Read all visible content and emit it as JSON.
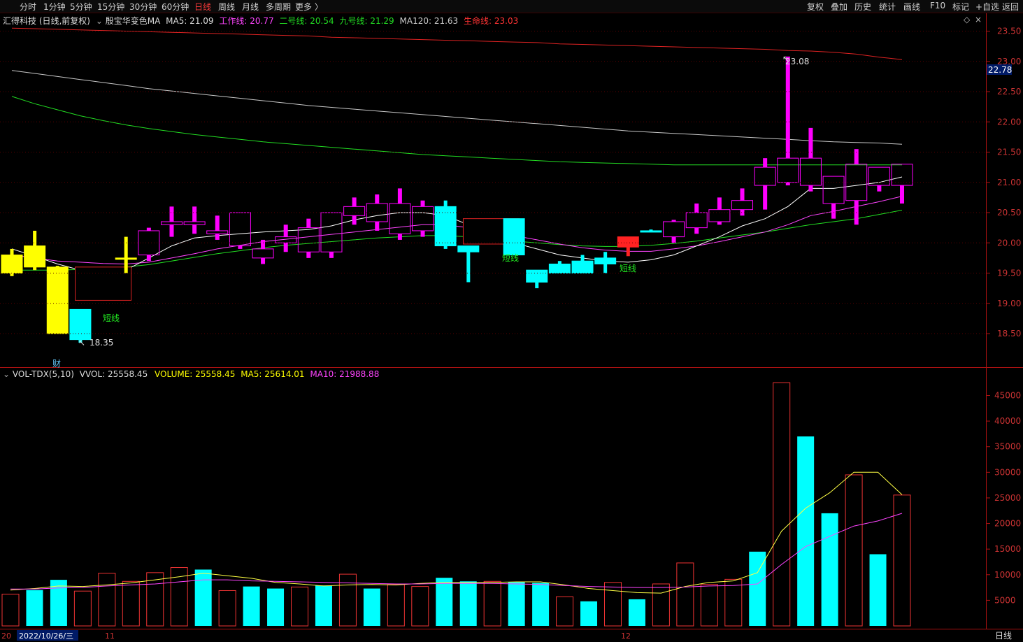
{
  "toolbar": {
    "left_tabs": [
      "分时",
      "1分钟",
      "5分钟",
      "15分钟",
      "30分钟",
      "60分钟",
      "日线",
      "周线",
      "月线",
      "多周期",
      "更多 〉"
    ],
    "active_tab": "日线",
    "right_buttons": [
      "复权",
      "叠加",
      "历史",
      "统计",
      "画线",
      "F10",
      "标记",
      "+自选",
      "返回"
    ]
  },
  "colors": {
    "up": "#ff00ff",
    "down": "#00ffff",
    "yellow": "#ffff00",
    "ma_white": "#ffffff",
    "ma_magenta": "#ff44ff",
    "ma_green": "#22dd22",
    "ma120": "#c8c8c8",
    "lifeline": "#dd2222",
    "grid": "#5a0000",
    "axis": "#aa1111"
  },
  "price_legend": {
    "stock": "汇得科技 (日线,前复权)",
    "indicator": "殷宝华变色MA",
    "ma5": "MA5: 21.09",
    "work": "工作线: 20.77",
    "second": "二号线: 20.54",
    "nine": "九号线: 21.29",
    "ma120": "MA120: 21.63",
    "life": "生命线: 23.03"
  },
  "vol_legend": {
    "name": "VOL-TDX(5,10)",
    "vvol": "VVOL: 25558.45",
    "volume": "VOLUME: 25558.45",
    "ma5": "MA5: 25614.01",
    "ma10": "MA10: 21988.88"
  },
  "current_price_tag": "22.78",
  "period_label": "日线",
  "annotations": {
    "high_label": "23.08",
    "low_label": "18.35",
    "short_label": "短线",
    "cai_label": "财"
  },
  "x_axis": {
    "start": "20",
    "date": "2022/10/26/三",
    "m11": "11",
    "m12": "12"
  },
  "chart_data": [
    {
      "type": "candlestick",
      "title": "汇得科技 (日线,前复权)",
      "y_ticks": [
        23.5,
        23.0,
        22.5,
        22.0,
        21.5,
        21.0,
        20.5,
        20.0,
        19.5,
        19.0,
        18.5
      ],
      "ylim": [
        18.0,
        23.8
      ],
      "candles": [
        {
          "o": 19.5,
          "h": 19.9,
          "l": 19.45,
          "c": 19.8,
          "t": "yellow"
        },
        {
          "o": 19.6,
          "h": 20.2,
          "l": 19.55,
          "c": 19.95,
          "t": "yellow"
        },
        {
          "o": 19.6,
          "h": 19.62,
          "l": 18.5,
          "c": 18.5,
          "t": "yellow"
        },
        {
          "o": 18.9,
          "h": 18.9,
          "l": 18.35,
          "c": 18.4,
          "t": "down"
        },
        {
          "o": 19.05,
          "h": 19.62,
          "l": 19.05,
          "c": 19.6,
          "t": "box"
        },
        {
          "o": 19.75,
          "h": 20.1,
          "l": 19.5,
          "c": 19.75,
          "t": "yellow"
        },
        {
          "o": 19.8,
          "h": 20.25,
          "l": 19.7,
          "c": 20.2,
          "t": "up"
        },
        {
          "o": 20.3,
          "h": 20.6,
          "l": 20.1,
          "c": 20.35,
          "t": "up"
        },
        {
          "o": 20.35,
          "h": 20.6,
          "l": 20.15,
          "c": 20.3,
          "t": "up"
        },
        {
          "o": 20.15,
          "h": 20.45,
          "l": 20.05,
          "c": 20.2,
          "t": "up"
        },
        {
          "o": 20.5,
          "h": 20.5,
          "l": 19.9,
          "c": 19.95,
          "t": "up"
        },
        {
          "o": 19.9,
          "h": 20.05,
          "l": 19.65,
          "c": 19.75,
          "t": "up"
        },
        {
          "o": 20.0,
          "h": 20.3,
          "l": 19.85,
          "c": 20.1,
          "t": "up"
        },
        {
          "o": 19.85,
          "h": 20.4,
          "l": 19.75,
          "c": 20.25,
          "t": "up"
        },
        {
          "o": 19.85,
          "h": 20.5,
          "l": 19.75,
          "c": 20.5,
          "t": "up"
        },
        {
          "o": 20.45,
          "h": 20.75,
          "l": 20.3,
          "c": 20.6,
          "t": "up"
        },
        {
          "o": 20.35,
          "h": 20.8,
          "l": 20.2,
          "c": 20.65,
          "t": "up"
        },
        {
          "o": 20.65,
          "h": 20.9,
          "l": 20.05,
          "c": 20.15,
          "t": "up"
        },
        {
          "o": 20.6,
          "h": 20.7,
          "l": 20.1,
          "c": 20.2,
          "t": "up"
        },
        {
          "o": 20.6,
          "h": 20.7,
          "l": 19.9,
          "c": 19.95,
          "t": "down"
        },
        {
          "o": 19.95,
          "h": 19.95,
          "l": 19.35,
          "c": 19.85,
          "t": "down"
        },
        {
          "o": 19.98,
          "h": 20.4,
          "l": 19.98,
          "c": 20.4,
          "t": "box"
        },
        {
          "o": 20.4,
          "h": 20.4,
          "l": 19.8,
          "c": 19.8,
          "t": "down"
        },
        {
          "o": 19.55,
          "h": 19.55,
          "l": 19.25,
          "c": 19.35,
          "t": "down"
        },
        {
          "o": 19.65,
          "h": 19.7,
          "l": 19.5,
          "c": 19.5,
          "t": "down"
        },
        {
          "o": 19.7,
          "h": 19.8,
          "l": 19.5,
          "c": 19.5,
          "t": "down"
        },
        {
          "o": 19.75,
          "h": 19.85,
          "l": 19.5,
          "c": 19.65,
          "t": "down"
        },
        {
          "o": 19.93,
          "h": 20.1,
          "l": 19.78,
          "c": 20.1,
          "t": "red"
        },
        {
          "o": 20.2,
          "h": 20.22,
          "l": 20.18,
          "c": 20.2,
          "t": "down"
        },
        {
          "o": 20.1,
          "h": 20.38,
          "l": 20.0,
          "c": 20.35,
          "t": "up"
        },
        {
          "o": 20.25,
          "h": 20.65,
          "l": 20.15,
          "c": 20.5,
          "t": "up"
        },
        {
          "o": 20.35,
          "h": 20.75,
          "l": 20.3,
          "c": 20.55,
          "t": "up"
        },
        {
          "o": 20.55,
          "h": 20.9,
          "l": 20.45,
          "c": 20.7,
          "t": "up"
        },
        {
          "o": 20.95,
          "h": 21.4,
          "l": 20.55,
          "c": 21.25,
          "t": "up"
        },
        {
          "o": 21.0,
          "h": 23.08,
          "l": 20.95,
          "c": 21.4,
          "t": "up"
        },
        {
          "o": 21.4,
          "h": 21.9,
          "l": 20.85,
          "c": 20.95,
          "t": "up"
        },
        {
          "o": 21.1,
          "h": 21.1,
          "l": 20.4,
          "c": 20.65,
          "t": "up"
        },
        {
          "o": 21.3,
          "h": 21.55,
          "l": 20.3,
          "c": 20.7,
          "t": "up"
        },
        {
          "o": 21.25,
          "h": 21.25,
          "l": 20.85,
          "c": 20.95,
          "t": "up"
        },
        {
          "o": 21.3,
          "h": 21.3,
          "l": 20.65,
          "c": 20.95,
          "t": "up"
        }
      ],
      "lines": {
        "life": [
          23.55,
          23.54,
          23.53,
          23.52,
          23.51,
          23.5,
          23.49,
          23.48,
          23.47,
          23.46,
          23.45,
          23.44,
          23.43,
          23.42,
          23.4,
          23.39,
          23.38,
          23.37,
          23.36,
          23.35,
          23.34,
          23.33,
          23.32,
          23.31,
          23.29,
          23.28,
          23.27,
          23.26,
          23.25,
          23.24,
          23.23,
          23.22,
          23.21,
          23.2,
          23.18,
          23.17,
          23.15,
          23.12,
          23.07,
          23.03
        ],
        "ma120": [
          22.85,
          22.8,
          22.75,
          22.7,
          22.65,
          22.6,
          22.55,
          22.51,
          22.47,
          22.43,
          22.39,
          22.35,
          22.31,
          22.27,
          22.24,
          22.21,
          22.18,
          22.15,
          22.12,
          22.09,
          22.06,
          22.03,
          22.0,
          21.97,
          21.94,
          21.91,
          21.88,
          21.85,
          21.83,
          21.81,
          21.79,
          21.77,
          21.75,
          21.73,
          21.71,
          21.69,
          21.67,
          21.66,
          21.65,
          21.63
        ],
        "nine": [
          22.42,
          22.3,
          22.2,
          22.1,
          22.02,
          21.95,
          21.89,
          21.84,
          21.79,
          21.75,
          21.71,
          21.67,
          21.64,
          21.61,
          21.58,
          21.55,
          21.52,
          21.49,
          21.46,
          21.44,
          21.42,
          21.4,
          21.38,
          21.36,
          21.34,
          21.33,
          21.32,
          21.31,
          21.3,
          21.29,
          21.29,
          21.29,
          21.29,
          21.29,
          21.29,
          21.29,
          21.29,
          21.29,
          21.29,
          21.29
        ],
        "ma5": [
          19.9,
          19.78,
          19.65,
          19.55,
          19.5,
          19.55,
          19.75,
          19.95,
          20.08,
          20.12,
          20.15,
          20.18,
          20.2,
          20.22,
          20.28,
          20.38,
          20.45,
          20.5,
          20.5,
          20.45,
          20.3,
          20.15,
          20.0,
          19.9,
          19.8,
          19.75,
          19.7,
          19.68,
          19.72,
          19.8,
          19.95,
          20.1,
          20.28,
          20.4,
          20.6,
          20.9,
          20.9,
          20.95,
          21.0,
          21.09
        ],
        "work": [
          19.8,
          19.75,
          19.7,
          19.68,
          19.66,
          19.65,
          19.68,
          19.75,
          19.82,
          19.9,
          19.96,
          20.02,
          20.06,
          20.1,
          20.14,
          20.18,
          20.22,
          20.26,
          20.3,
          20.3,
          20.25,
          20.2,
          20.12,
          20.05,
          19.98,
          19.92,
          19.88,
          19.86,
          19.86,
          19.9,
          19.95,
          20.02,
          20.1,
          20.18,
          20.3,
          20.45,
          20.52,
          20.6,
          20.68,
          20.77
        ],
        "second": [
          19.55,
          19.55,
          19.55,
          19.56,
          19.58,
          19.6,
          19.64,
          19.7,
          19.76,
          19.82,
          19.87,
          19.92,
          19.96,
          19.99,
          20.02,
          20.05,
          20.08,
          20.1,
          20.12,
          20.12,
          20.1,
          20.07,
          20.03,
          20.0,
          19.97,
          19.95,
          19.94,
          19.94,
          19.96,
          19.99,
          20.03,
          20.08,
          20.13,
          20.18,
          20.24,
          20.3,
          20.35,
          20.4,
          20.47,
          20.54
        ]
      }
    },
    {
      "type": "bar",
      "title": "VOL-TDX(5,10)",
      "y_ticks": [
        45000,
        40000,
        35000,
        30000,
        25000,
        20000,
        15000,
        10000,
        5000
      ],
      "ylim": [
        0,
        50000
      ],
      "values": [
        6200,
        7000,
        9000,
        6800,
        10300,
        8700,
        10400,
        11400,
        11000,
        6900,
        7700,
        7300,
        7600,
        7900,
        10100,
        7300,
        8100,
        7700,
        9400,
        8700,
        8700,
        8600,
        8400,
        5700,
        4800,
        8500,
        5200,
        8200,
        12300,
        8100,
        9100,
        14500,
        47500,
        37000,
        22000,
        29500,
        14000,
        25558
      ],
      "dir": [
        "up",
        "down",
        "down",
        "up",
        "up",
        "up",
        "up",
        "up",
        "down",
        "up",
        "down",
        "down",
        "up",
        "down",
        "up",
        "down",
        "up",
        "up",
        "down",
        "down",
        "up",
        "down",
        "down",
        "up",
        "down",
        "up",
        "down",
        "up",
        "up",
        "up",
        "up",
        "down",
        "up",
        "down",
        "down",
        "up",
        "down",
        "up"
      ],
      "ma5": [
        7000,
        7300,
        7800,
        7700,
        8000,
        8400,
        9000,
        9600,
        10300,
        9800,
        9300,
        8500,
        8200,
        7800,
        8000,
        8100,
        8000,
        8300,
        8500,
        8500,
        8500,
        8600,
        8600,
        8000,
        7300,
        6900,
        6500,
        6400,
        7700,
        8500,
        8800,
        10400,
        18500,
        23000,
        26000,
        30000,
        30000,
        25614
      ],
      "ma10": [
        7200,
        7200,
        7400,
        7500,
        7800,
        8000,
        8200,
        8600,
        9000,
        9000,
        8800,
        8700,
        8600,
        8500,
        8400,
        8300,
        8200,
        8200,
        8300,
        8300,
        8300,
        8200,
        8100,
        7900,
        7700,
        7600,
        7500,
        7500,
        7600,
        7800,
        7900,
        8200,
        12000,
        15500,
        17500,
        19500,
        20500,
        21988
      ]
    }
  ]
}
